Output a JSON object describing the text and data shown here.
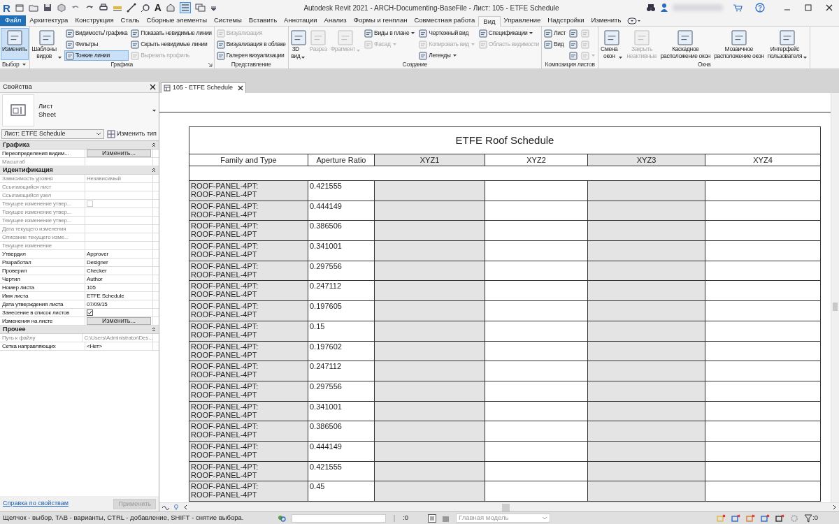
{
  "window": {
    "app_logo": "R",
    "text_tool_glyph": "A",
    "title": "Autodesk Revit 2021 - ARCH-Documenting-BaseFile - Лист: 105 - ETFE Schedule"
  },
  "menu_tabs": [
    {
      "label": "Файл",
      "kind": "file",
      "selected": false
    },
    {
      "label": "Архитектура",
      "kind": "tab",
      "selected": false
    },
    {
      "label": "Конструкция",
      "kind": "tab",
      "selected": false
    },
    {
      "label": "Сталь",
      "kind": "tab",
      "selected": false
    },
    {
      "label": "Сборные элементы",
      "kind": "tab",
      "selected": false
    },
    {
      "label": "Системы",
      "kind": "tab",
      "selected": false
    },
    {
      "label": "Вставить",
      "kind": "tab",
      "selected": false
    },
    {
      "label": "Аннотации",
      "kind": "tab",
      "selected": false
    },
    {
      "label": "Анализ",
      "kind": "tab",
      "selected": false
    },
    {
      "label": "Формы и генплан",
      "kind": "tab",
      "selected": false
    },
    {
      "label": "Совместная работа",
      "kind": "tab",
      "selected": false
    },
    {
      "label": "Вид",
      "kind": "tab",
      "selected": true
    },
    {
      "label": "Управление",
      "kind": "tab",
      "selected": false
    },
    {
      "label": "Надстройки",
      "kind": "tab",
      "selected": false
    },
    {
      "label": "Изменить",
      "kind": "tab",
      "selected": false
    }
  ],
  "ribbon": [
    {
      "label": "Выбор",
      "dropdown": true,
      "launcher": false,
      "groups": [
        {
          "kind": "large",
          "label": "Изменить",
          "selected": true,
          "disabled": false,
          "dropdown": false
        }
      ]
    },
    {
      "label": "Графика",
      "dropdown": false,
      "launcher": true,
      "groups": [
        {
          "kind": "large",
          "label": "Шаблоны\nвидов",
          "selected": false,
          "disabled": false,
          "dropdown": true
        },
        {
          "kind": "stack",
          "items": [
            {
              "label": "Видимость/ графика",
              "selected": false,
              "disabled": false,
              "dropdown": false
            },
            {
              "label": "Фильтры",
              "selected": false,
              "disabled": false,
              "dropdown": false
            },
            {
              "label": "Тонкие линии",
              "selected": true,
              "disabled": false,
              "dropdown": false
            }
          ]
        },
        {
          "kind": "stack",
          "items": [
            {
              "label": "Показать невидимые линии",
              "selected": false,
              "disabled": false,
              "dropdown": false
            },
            {
              "label": "Скрыть невидимые линии",
              "selected": false,
              "disabled": false,
              "dropdown": false
            },
            {
              "label": "Вырезать профиль",
              "selected": false,
              "disabled": true,
              "dropdown": false
            }
          ]
        }
      ]
    },
    {
      "label": "Представление",
      "dropdown": false,
      "launcher": false,
      "groups": [
        {
          "kind": "stack",
          "items": [
            {
              "label": "Визуализация",
              "selected": false,
              "disabled": true,
              "dropdown": false
            },
            {
              "label": "Визуализация  в облаке",
              "selected": false,
              "disabled": false,
              "dropdown": false
            },
            {
              "label": "Галерея  визуализации",
              "selected": false,
              "disabled": false,
              "dropdown": false
            }
          ]
        }
      ]
    },
    {
      "label": "Создание",
      "dropdown": false,
      "launcher": false,
      "groups": [
        {
          "kind": "large",
          "label": "3D\nвид",
          "selected": false,
          "disabled": false,
          "dropdown": true
        },
        {
          "kind": "large",
          "label": "Разрез",
          "selected": false,
          "disabled": true,
          "dropdown": false
        },
        {
          "kind": "large",
          "label": "Фрагмент",
          "selected": false,
          "disabled": true,
          "dropdown": true
        },
        {
          "kind": "stack",
          "items": [
            {
              "label": "Виды в плане",
              "selected": false,
              "disabled": false,
              "dropdown": true
            },
            {
              "label": "Фасад",
              "selected": false,
              "disabled": true,
              "dropdown": true
            }
          ]
        },
        {
          "kind": "stack",
          "items": [
            {
              "label": "Чертежный вид",
              "selected": false,
              "disabled": false,
              "dropdown": false
            },
            {
              "label": "Копировать вид",
              "selected": false,
              "disabled": true,
              "dropdown": true
            },
            {
              "label": "Легенды",
              "selected": false,
              "disabled": false,
              "dropdown": true
            }
          ]
        },
        {
          "kind": "stack",
          "items": [
            {
              "label": "Спецификации",
              "selected": false,
              "disabled": false,
              "dropdown": true
            },
            {
              "label": "Область видимости",
              "selected": false,
              "disabled": true,
              "dropdown": false
            }
          ]
        }
      ]
    },
    {
      "label": "Композиция листов",
      "dropdown": false,
      "launcher": false,
      "groups": [
        {
          "kind": "stack",
          "items": [
            {
              "label": "Лист",
              "selected": false,
              "disabled": false,
              "dropdown": false
            },
            {
              "label": "Вид",
              "selected": false,
              "disabled": false,
              "dropdown": false
            }
          ]
        },
        {
          "kind": "stack",
          "items": [
            {
              "selected": false,
              "disabled": false,
              "dropdown": false
            },
            {
              "selected": false,
              "disabled": false,
              "dropdown": false
            },
            {
              "selected": false,
              "disabled": false,
              "dropdown": false
            }
          ]
        },
        {
          "kind": "stack",
          "items": [
            {
              "selected": false,
              "disabled": true,
              "dropdown": false
            },
            {
              "selected": false,
              "disabled": true,
              "dropdown": false
            },
            {
              "selected": false,
              "disabled": true,
              "dropdown": true
            }
          ]
        }
      ]
    },
    {
      "label": "Окна",
      "dropdown": false,
      "launcher": false,
      "groups": [
        {
          "kind": "large",
          "label": "Смена\nокон",
          "selected": false,
          "disabled": false,
          "dropdown": true
        },
        {
          "kind": "large",
          "label": "Закрыть\nнеактивные",
          "selected": false,
          "disabled": true,
          "dropdown": false
        },
        {
          "kind": "large",
          "label": "Каскадное\nрасположение окон",
          "selected": false,
          "disabled": false,
          "dropdown": false
        },
        {
          "kind": "large",
          "label": "Мозаичное\nрасположение окон",
          "selected": false,
          "disabled": false,
          "dropdown": false
        },
        {
          "kind": "large",
          "label": "Интерфейс\nпользователя",
          "selected": false,
          "disabled": false,
          "dropdown": true
        }
      ]
    }
  ],
  "properties": {
    "title": "Свойства",
    "type_name": "Лист",
    "type_subname": "Sheet",
    "instance_selector": "Лист: ETFE Schedule",
    "edit_type_button": "Изменить тип",
    "groups": [
      {
        "label": "Графика",
        "rows": [
          {
            "label": "Переопределения видим...",
            "kind": "button",
            "value": "Изменить...",
            "disabled": false
          },
          {
            "label": "Масштаб",
            "kind": "text",
            "disabled": true
          }
        ]
      },
      {
        "label": "Идентификация",
        "rows": [
          {
            "label": "Зависимость уровня",
            "kind": "text",
            "value": "Независимый",
            "disabled": true
          },
          {
            "label": "Ссылающийся лист",
            "kind": "text",
            "disabled": true
          },
          {
            "label": "Ссылающийся узел",
            "kind": "text",
            "disabled": true
          },
          {
            "label": "Текущее изменение утвер...",
            "kind": "checkbox",
            "checked": false,
            "disabled": true
          },
          {
            "label": "Текущее изменение утвер...",
            "kind": "text",
            "disabled": true
          },
          {
            "label": "Текущее изменение утвер...",
            "kind": "text",
            "disabled": true
          },
          {
            "label": "Дата текущего изменения",
            "kind": "text",
            "disabled": true
          },
          {
            "label": "Описание текущего изме...",
            "kind": "text",
            "disabled": true
          },
          {
            "label": "Текущее изменение",
            "kind": "text",
            "disabled": true
          },
          {
            "label": "Утвердил",
            "kind": "text",
            "value": "Approver",
            "disabled": false
          },
          {
            "label": "Разработал",
            "kind": "text",
            "value": "Designer",
            "disabled": false
          },
          {
            "label": "Проверил",
            "kind": "text",
            "value": "Checker",
            "disabled": false
          },
          {
            "label": "Чертил",
            "kind": "text",
            "value": "Author",
            "disabled": false
          },
          {
            "label": "Номер листа",
            "kind": "text",
            "value": "105",
            "disabled": false
          },
          {
            "label": "Имя листа",
            "kind": "text",
            "value": "ETFE Schedule",
            "disabled": false
          },
          {
            "label": "Дата утверждения листа",
            "kind": "text",
            "value": "07/09/15",
            "disabled": false
          },
          {
            "label": "Занесение в список листов",
            "kind": "checkbox",
            "checked": true,
            "disabled": false
          },
          {
            "label": "Изменения на листе",
            "kind": "button",
            "value": "Изменить...",
            "disabled": false
          }
        ]
      },
      {
        "label": "Прочее",
        "rows": [
          {
            "label": "Путь к файлу",
            "kind": "text",
            "value": "C:\\Users\\Administrator\\Des...",
            "disabled": true
          },
          {
            "label": "Сетка направляющих",
            "kind": "text",
            "value": "<Нет>",
            "disabled": false
          }
        ]
      }
    ],
    "help_link": "Справка по свойствам",
    "apply_button": "Применить"
  },
  "document_tab": {
    "label": "105 - ETFE Schedule",
    "selected": true
  },
  "schedule": {
    "title": "ETFE Roof Schedule",
    "columns": [
      {
        "label": "Family and Type",
        "header_shaded": false,
        "cells_shaded": true
      },
      {
        "label": "Aperture Ratio",
        "header_shaded": false,
        "cells_shaded": false
      },
      {
        "label": "XYZ1",
        "header_shaded": true,
        "cells_shaded": true
      },
      {
        "label": "XYZ2",
        "header_shaded": false,
        "cells_shaded": false
      },
      {
        "label": "XYZ3",
        "header_shaded": true,
        "cells_shaded": true
      },
      {
        "label": "XYZ4",
        "header_shaded": false,
        "cells_shaded": false
      }
    ],
    "rows": [
      {
        "family_and_type": "ROOF-PANEL-4PT:\nROOF-PANEL-4PT",
        "aperture_ratio": "0.421555"
      },
      {
        "family_and_type": "ROOF-PANEL-4PT:\nROOF-PANEL-4PT",
        "aperture_ratio": "0.444149"
      },
      {
        "family_and_type": "ROOF-PANEL-4PT:\nROOF-PANEL-4PT",
        "aperture_ratio": "0.386506"
      },
      {
        "family_and_type": "ROOF-PANEL-4PT:\nROOF-PANEL-4PT",
        "aperture_ratio": "0.341001"
      },
      {
        "family_and_type": "ROOF-PANEL-4PT:\nROOF-PANEL-4PT",
        "aperture_ratio": "0.297556"
      },
      {
        "family_and_type": "ROOF-PANEL-4PT:\nROOF-PANEL-4PT",
        "aperture_ratio": "0.247112"
      },
      {
        "family_and_type": "ROOF-PANEL-4PT:\nROOF-PANEL-4PT",
        "aperture_ratio": "0.197605"
      },
      {
        "family_and_type": "ROOF-PANEL-4PT:\nROOF-PANEL-4PT",
        "aperture_ratio": "0.15"
      },
      {
        "family_and_type": "ROOF-PANEL-4PT:\nROOF-PANEL-4PT",
        "aperture_ratio": "0.197602"
      },
      {
        "family_and_type": "ROOF-PANEL-4PT:\nROOF-PANEL-4PT",
        "aperture_ratio": "0.247112"
      },
      {
        "family_and_type": "ROOF-PANEL-4PT:\nROOF-PANEL-4PT",
        "aperture_ratio": "0.297556"
      },
      {
        "family_and_type": "ROOF-PANEL-4PT:\nROOF-PANEL-4PT",
        "aperture_ratio": "0.341001"
      },
      {
        "family_and_type": "ROOF-PANEL-4PT:\nROOF-PANEL-4PT",
        "aperture_ratio": "0.386506"
      },
      {
        "family_and_type": "ROOF-PANEL-4PT:\nROOF-PANEL-4PT",
        "aperture_ratio": "0.444149"
      },
      {
        "family_and_type": "ROOF-PANEL-4PT:\nROOF-PANEL-4PT",
        "aperture_ratio": "0.421555"
      },
      {
        "family_and_type": "ROOF-PANEL-4PT:\nROOF-PANEL-4PT",
        "aperture_ratio": "0.45"
      }
    ]
  },
  "status_bar": {
    "hint": "Щелчок - выбор, TAB - варианты, CTRL - добавление, SHIFT - снятие выбора.",
    "workset_count": ":0",
    "design_option": "Главная модель",
    "filter_count": ":0"
  }
}
